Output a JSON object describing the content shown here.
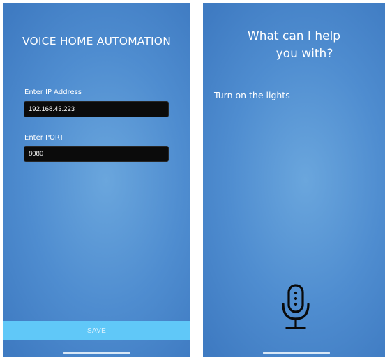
{
  "setup_screen": {
    "title": "VOICE HOME AUTOMATION",
    "ip_field": {
      "label": "Enter IP Address",
      "value": "192.168.43.223"
    },
    "port_field": {
      "label": "Enter PORT",
      "value": "8080"
    },
    "save_label": "SAVE"
  },
  "assistant_screen": {
    "prompt_line_1": "What can I help",
    "prompt_line_2": "you with?",
    "transcript": "Turn on the lights",
    "mic_icon": "microphone-icon"
  },
  "colors": {
    "background_center": "#6aa6dd",
    "background_edge": "#3f7bc2",
    "save_button": "#60c8f8",
    "input_background": "#0b0b0b",
    "text": "#ffffff"
  }
}
